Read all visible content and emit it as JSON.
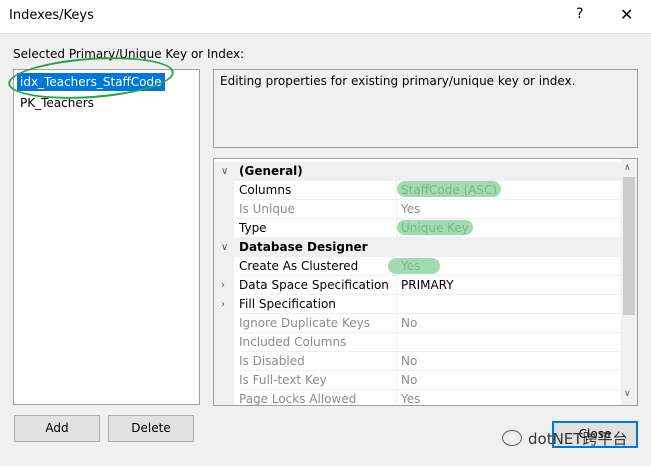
{
  "window": {
    "title": "Indexes/Keys",
    "help_glyph": "?",
    "close_glyph": "✕"
  },
  "left_panel": {
    "label": "Selected Primary/Unique Key or Index:",
    "items": [
      {
        "name": "idx_Teachers_StaffCode",
        "selected": true
      },
      {
        "name": "PK_Teachers",
        "selected": false
      }
    ]
  },
  "description": "Editing properties for existing primary/unique key or index.",
  "property_grid": {
    "rows": [
      {
        "type": "category",
        "name": "(General)",
        "toggle": "∨"
      },
      {
        "type": "property",
        "name": "Columns",
        "value": "StaffCode (ASC)",
        "disabled": false
      },
      {
        "type": "property",
        "name": "Is Unique",
        "value": "Yes",
        "disabled": true
      },
      {
        "type": "property",
        "name": "Type",
        "value": "Unique Key",
        "disabled": false
      },
      {
        "type": "category",
        "name": "Database Designer",
        "toggle": "∨"
      },
      {
        "type": "property",
        "name": "Create As Clustered",
        "value": "Yes",
        "disabled": false
      },
      {
        "type": "property",
        "name": "Data Space Specification",
        "value": "PRIMARY",
        "disabled": false,
        "expander": "›"
      },
      {
        "type": "property",
        "name": "Fill Specification",
        "value": "",
        "disabled": false,
        "expander": "›"
      },
      {
        "type": "property",
        "name": "Ignore Duplicate Keys",
        "value": "No",
        "disabled": true
      },
      {
        "type": "property",
        "name": "Included Columns",
        "value": "",
        "disabled": true
      },
      {
        "type": "property",
        "name": "Is Disabled",
        "value": "No",
        "disabled": true
      },
      {
        "type": "property",
        "name": "Is Full-text Key",
        "value": "No",
        "disabled": true
      },
      {
        "type": "property",
        "name": "Page Locks Allowed",
        "value": "Yes",
        "disabled": true
      }
    ]
  },
  "buttons": {
    "add": "Add",
    "delete": "Delete",
    "close": "Close"
  },
  "watermark": "dotNET跨平台",
  "colors": {
    "selection": "#0078d7",
    "annotation_green": "#24a648",
    "highlight_green": "#8fd6a2"
  }
}
